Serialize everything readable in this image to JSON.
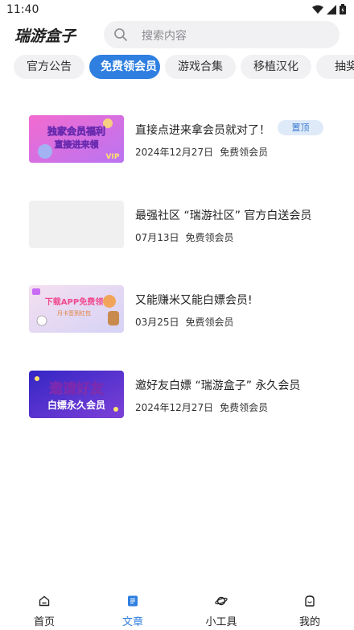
{
  "status_bar": {
    "time": "11:40"
  },
  "app": {
    "title": "瑞游盒子"
  },
  "search": {
    "placeholder": "搜索内容"
  },
  "tabs": [
    {
      "label": "官方公告",
      "active": false
    },
    {
      "label": "免费领会员",
      "active": true
    },
    {
      "label": "游戏合集",
      "active": false
    },
    {
      "label": "移植汉化",
      "active": false
    },
    {
      "label": "抽奖活",
      "active": false
    }
  ],
  "articles": [
    {
      "title": "直接点进来拿会员就对了！",
      "date": "2024年12月27日",
      "category": "免费领会员",
      "badge": "置顶",
      "thumb_text": [
        "独家会员福利",
        "直接进来领",
        "VIP"
      ],
      "thumb_colors": [
        "#f06ad8",
        "#c86cf5"
      ]
    },
    {
      "title": "最强社区 “瑞游社区” 官方白送会员",
      "date": "07月13日",
      "category": "免费领会员",
      "thumb_colors": [
        "#f0f0f0",
        "#f0f0f0"
      ]
    },
    {
      "title": "又能赚米又能白嫖会员!",
      "date": "03月25日",
      "category": "免费领会员",
      "thumb_text": [
        "下载APP免费领",
        "月卡签到红包"
      ],
      "thumb_colors": [
        "#f3dcef",
        "#d9d4f5"
      ]
    },
    {
      "title": "邀好友白嫖 “瑞游盒子” 永久会员",
      "date": "2024年12月27日",
      "category": "免费领会员",
      "thumb_text": [
        "邀请好友",
        "白嫖永久会员"
      ],
      "thumb_colors": [
        "#3b2fc9",
        "#7a3fd6"
      ]
    }
  ],
  "bottom_nav": [
    {
      "label": "首页",
      "icon": "home-icon",
      "active": false
    },
    {
      "label": "文章",
      "icon": "article-icon",
      "active": true
    },
    {
      "label": "小工具",
      "icon": "planet-icon",
      "active": false
    },
    {
      "label": "我的",
      "icon": "profile-icon",
      "active": false
    }
  ],
  "colors": {
    "accent": "#2f7fe0",
    "badge_bg": "#dfeaf9",
    "badge_text": "#3d7bd0"
  }
}
